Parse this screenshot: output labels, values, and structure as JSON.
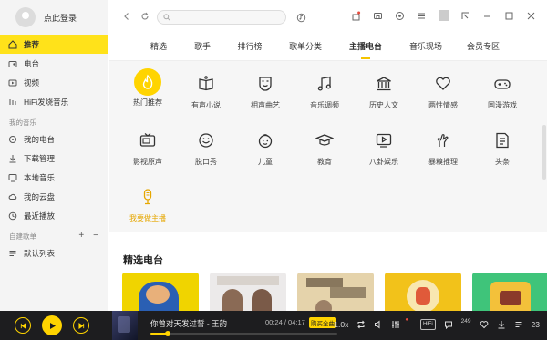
{
  "colors": {
    "accent": "#ffd400",
    "player_bg": "#1d1d1f",
    "sidebar_bg": "#f4f4f4",
    "panel_bg": "#f6f6f6"
  },
  "sidebar": {
    "login_label": "点此登录",
    "main_items": [
      {
        "label": "推荐",
        "icon": "home-icon",
        "active": true
      },
      {
        "label": "电台",
        "icon": "radio-icon"
      },
      {
        "label": "视频",
        "icon": "video-icon"
      },
      {
        "label": "HiFi发烧音乐",
        "icon": "hifi-icon"
      }
    ],
    "my_music_title": "我的音乐",
    "my_items": [
      {
        "label": "我的电台",
        "icon": "station-icon"
      },
      {
        "label": "下载管理",
        "icon": "download-icon"
      },
      {
        "label": "本地音乐",
        "icon": "local-music-icon"
      },
      {
        "label": "我的云盘",
        "icon": "cloud-icon"
      },
      {
        "label": "最近播放",
        "icon": "clock-icon"
      }
    ],
    "playlist_title": "自建歌单",
    "playlist_add": "+",
    "playlist_collapse": "−",
    "playlist_items": [
      {
        "label": "默认列表",
        "icon": "list-icon"
      }
    ]
  },
  "search": {
    "placeholder": ""
  },
  "tabs": [
    {
      "label": "精选"
    },
    {
      "label": "歌手"
    },
    {
      "label": "排行榜"
    },
    {
      "label": "歌单分类"
    },
    {
      "label": "主播电台",
      "active": true
    },
    {
      "label": "音乐现场"
    },
    {
      "label": "会员专区"
    }
  ],
  "categories": [
    {
      "label": "热门推荐",
      "icon": "flame-icon"
    },
    {
      "label": "有声小说",
      "icon": "book-icon"
    },
    {
      "label": "相声曲艺",
      "icon": "mask-icon"
    },
    {
      "label": "音乐调频",
      "icon": "music-note-icon"
    },
    {
      "label": "历史人文",
      "icon": "building-icon"
    },
    {
      "label": "两性情感",
      "icon": "heart-icon"
    },
    {
      "label": "国漫游戏",
      "icon": "gamepad-icon"
    },
    {
      "label": "影视原声",
      "icon": "tv-icon"
    },
    {
      "label": "脱口秀",
      "icon": "smile-icon"
    },
    {
      "label": "儿童",
      "icon": "child-icon"
    },
    {
      "label": "教育",
      "icon": "graduation-cap-icon"
    },
    {
      "label": "八卦娱乐",
      "icon": "play-screen-icon"
    },
    {
      "label": "暴糗推理",
      "icon": "hand-icon"
    },
    {
      "label": "头条",
      "icon": "news-icon"
    },
    {
      "label": "我要做主播",
      "icon": "microphone-icon"
    }
  ],
  "section_title": "精选电台",
  "player": {
    "song": "你曾对天发过誓 - 王韵",
    "time": "00:24 / 04:17",
    "buy_label": "购买全曲",
    "progress": 0.093,
    "speed": "1.0x",
    "hifi_label": "HiFi",
    "comment_count": "249",
    "playlist_count": "23"
  }
}
